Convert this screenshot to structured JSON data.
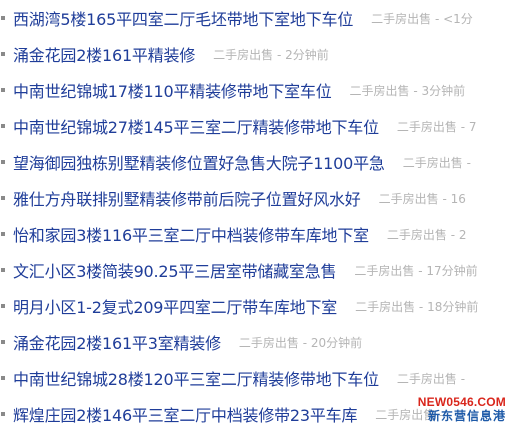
{
  "listings": [
    {
      "title": "西湖湾5楼165平四室二厅毛坯带地下室地下车位",
      "category": "二手房出售",
      "time": "<1分"
    },
    {
      "title": "涌金花园2楼161平精装修",
      "category": "二手房出售",
      "time": "2分钟前"
    },
    {
      "title": "中南世纪锦城17楼110平精装修带地下室车位",
      "category": "二手房出售",
      "time": "3分钟前"
    },
    {
      "title": "中南世纪锦城27楼145平三室二厅精装修带地下车位",
      "category": "二手房出售",
      "time": "7"
    },
    {
      "title": "望海御园独栋别墅精装修位置好急售大院子1100平急",
      "category": "二手房出售",
      "time": ""
    },
    {
      "title": "雅仕方舟联排别墅精装修带前后院子位置好风水好",
      "category": "二手房出售",
      "time": "16"
    },
    {
      "title": "怡和家园3楼116平三室二厅中档装修带车库地下室",
      "category": "二手房出售",
      "time": "2"
    },
    {
      "title": "文汇小区3楼简装90.25平三居室带储藏室急售",
      "category": "二手房出售",
      "time": "17分钟前"
    },
    {
      "title": "明月小区1-2复式209平四室二厅带车库地下室",
      "category": "二手房出售",
      "time": "18分钟前"
    },
    {
      "title": "涌金花园2楼161平3室精装修",
      "category": "二手房出售",
      "time": "20分钟前"
    },
    {
      "title": "中南世纪锦城28楼120平三室二厅精装修带地下车位",
      "category": "二手房出售",
      "time": ""
    },
    {
      "title": "辉煌庄园2楼146平三室二厅中档装修带23平车库",
      "category": "二手房出售",
      "time": ""
    }
  ],
  "separator": " - ",
  "watermark": {
    "domain": "NEW0546.COM",
    "name": "新东营信息港"
  }
}
